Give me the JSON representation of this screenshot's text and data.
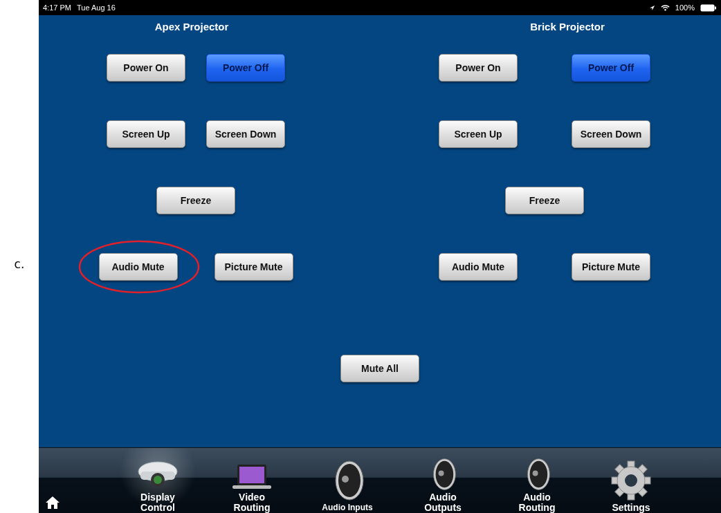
{
  "caption": "c.",
  "status_bar": {
    "time": "4:17 PM",
    "date": "Tue Aug 16",
    "battery": "100%"
  },
  "projectors": [
    {
      "title": "Apex Projector",
      "rows": [
        [
          {
            "label": "Power On",
            "selected": false,
            "circled": false
          },
          {
            "label": "Power Off",
            "selected": true,
            "circled": false
          }
        ],
        [
          {
            "label": "Screen Up",
            "selected": false,
            "circled": false
          },
          {
            "label": "Screen Down",
            "selected": false,
            "circled": false
          }
        ],
        [
          {
            "label": "Freeze",
            "selected": false,
            "circled": false
          }
        ],
        [
          {
            "label": "Audio Mute",
            "selected": false,
            "circled": true
          },
          {
            "label": "Picture Mute",
            "selected": false,
            "circled": false
          }
        ]
      ]
    },
    {
      "title": "Brick Projector",
      "rows": [
        [
          {
            "label": "Power On",
            "selected": false,
            "circled": false
          },
          {
            "label": "Power Off",
            "selected": true,
            "circled": false
          }
        ],
        [
          {
            "label": "Screen Up",
            "selected": false,
            "circled": false
          },
          {
            "label": "Screen Down",
            "selected": false,
            "circled": false
          }
        ],
        [
          {
            "label": "Freeze",
            "selected": false,
            "circled": false
          }
        ],
        [
          {
            "label": "Audio Mute",
            "selected": false,
            "circled": false
          },
          {
            "label": "Picture Mute",
            "selected": false,
            "circled": false
          }
        ]
      ]
    }
  ],
  "mute_all": {
    "label": "Mute All",
    "selected": false
  },
  "tabs": [
    {
      "kind": "projector",
      "label": "Display Control",
      "selected": true
    },
    {
      "kind": "laptop",
      "label": "Video Routing",
      "selected": false
    },
    {
      "kind": "speaker-large",
      "label": "Audio Inputs",
      "selected": false
    },
    {
      "kind": "speaker",
      "label": "Audio Outputs",
      "selected": false
    },
    {
      "kind": "speaker",
      "label": "Audio Routing",
      "selected": false
    },
    {
      "kind": "gear",
      "label": "Settings",
      "selected": false
    }
  ]
}
